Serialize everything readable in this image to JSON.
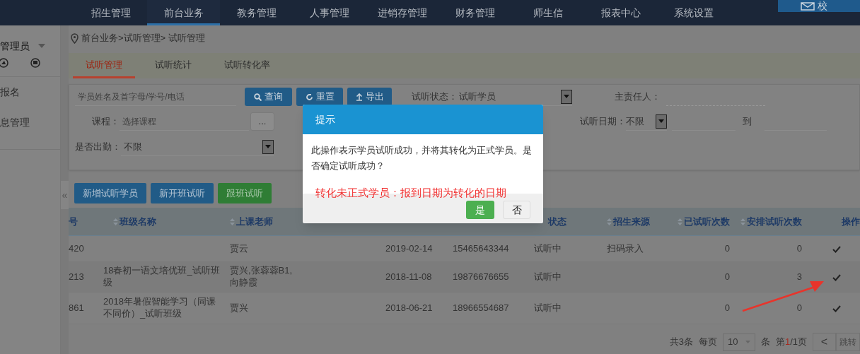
{
  "nav": {
    "items": [
      {
        "label": "招生管理",
        "selected": false
      },
      {
        "label": "前台业务",
        "selected": true
      },
      {
        "label": "教务管理",
        "selected": false
      },
      {
        "label": "人事管理",
        "selected": false
      },
      {
        "label": "进销存管理",
        "selected": false
      },
      {
        "label": "财务管理",
        "selected": false
      },
      {
        "label": "师生信",
        "selected": false
      },
      {
        "label": "报表中心",
        "selected": false
      },
      {
        "label": "系统设置",
        "selected": false
      }
    ],
    "campus": "校"
  },
  "sidebar": {
    "user": "管理员",
    "items": [
      "报名",
      "息管理"
    ],
    "collapse": "«"
  },
  "breadcrumb": "前台业务>试听管理> 试听管理",
  "tabs": [
    {
      "label": "试听管理",
      "selected": true
    },
    {
      "label": "试听统计",
      "selected": false
    },
    {
      "label": "试听转化率",
      "selected": false
    }
  ],
  "filters": {
    "search_placeholder": "学员姓名及首字母/学号/电话",
    "query": "查询",
    "reset": "重置",
    "export": "导出",
    "status_label": "试听状态：",
    "status_value": "试听学员",
    "owner_label": "主责任人：",
    "course_label": "课程：",
    "course_placeholder": "选择课程",
    "course_button": "...",
    "date_label": "试听日期：",
    "date_value": "不限",
    "date_to": "到",
    "attend_label": "是否出勤：",
    "attend_value": "不限"
  },
  "actions": [
    {
      "label": "新增试听学员",
      "kind": "primary"
    },
    {
      "label": "新开班试听",
      "kind": "primary"
    },
    {
      "label": "跟班试听",
      "kind": "success"
    }
  ],
  "table": {
    "columns": [
      {
        "label": "号",
        "sortable": false
      },
      {
        "label": "班级名称",
        "sortable": true
      },
      {
        "label": "上课老师",
        "sortable": true
      },
      {
        "label": "状态",
        "sortable": false
      },
      {
        "label": "招生来源",
        "sortable": true
      },
      {
        "label": "已试听次数",
        "sortable": true
      },
      {
        "label": "安排试听次数",
        "sortable": true
      },
      {
        "label": "操作",
        "sortable": false
      }
    ],
    "rows": [
      {
        "id": "420",
        "teacher": "贾云",
        "date": "2019-02-14",
        "phone": "15465643344",
        "status": "试听中",
        "source": "扫码录入",
        "tried": "0",
        "scheduled": "0"
      },
      {
        "id": "213",
        "class_name": "18春初一语文培优班_试听班级",
        "teacher": "贾兴,张蓉蓉B1,向静霞",
        "date": "2018-11-08",
        "phone": "19876676655",
        "status": "试听中",
        "tried": "0",
        "scheduled": "3"
      },
      {
        "id": "861",
        "class_name": "2018年暑假智能学习（同课不同价）_试听班级",
        "teacher": "贾兴",
        "date": "2018-06-21",
        "phone": "18966554687",
        "status": "试听中",
        "tried": "0",
        "scheduled": "0"
      }
    ]
  },
  "pagination": {
    "total": "共3条",
    "per_page_label": "每页",
    "per_page": "10",
    "unit": "条",
    "page_prefix": "第",
    "page_current": "1",
    "page_suffix": "/1页",
    "prev": "<",
    "jump": "跳转"
  },
  "dialog": {
    "title": "提示",
    "message": "此操作表示学员试听成功，并将其转化为正式学员。是否确定试听成功？",
    "note": "转化未正式学员：报到日期为转化的日期",
    "confirm": "是",
    "cancel": "否"
  }
}
